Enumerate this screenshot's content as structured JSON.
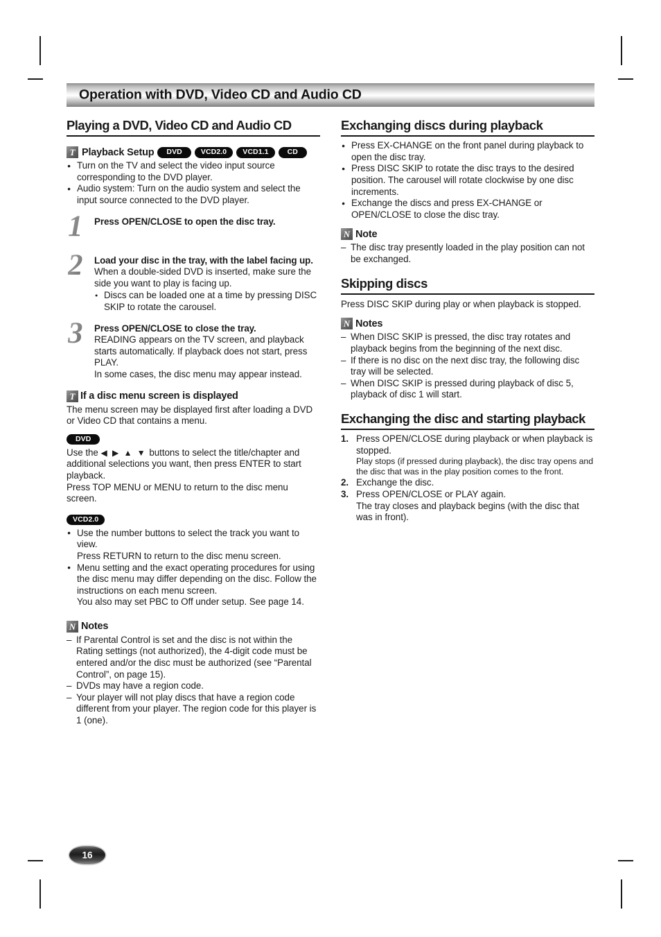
{
  "chapter": {
    "title": "Operation with DVD, Video CD and Audio CD"
  },
  "icons": {
    "tip": "T",
    "note": "N"
  },
  "left": {
    "heading": "Playing a DVD, Video CD and Audio CD",
    "playback_setup": {
      "label": "Playback Setup",
      "badges": [
        "DVD",
        "VCD2.0",
        "VCD1.1",
        "CD"
      ],
      "bullets": [
        "Turn on the TV and select the video input source corresponding to the DVD player.",
        "Audio system: Turn on the audio system and select the input source connected to the DVD player."
      ]
    },
    "steps": [
      {
        "num": "1",
        "head": "Press OPEN/CLOSE to open the disc tray.",
        "body": "",
        "bullets": []
      },
      {
        "num": "2",
        "head": "Load your disc in the tray, with the label facing up.",
        "body": "When a double-sided DVD is inserted, make sure the side you want to play is facing up.",
        "bullets": [
          "Discs can be loaded one at a time by pressing DISC SKIP to rotate the carousel."
        ]
      },
      {
        "num": "3",
        "head": "Press OPEN/CLOSE to close the tray.",
        "body": "READING appears on the TV screen, and playback starts automatically. If playback does not start, press PLAY.",
        "body2": "In some cases, the disc menu may appear instead.",
        "bullets": []
      }
    ],
    "disc_menu": {
      "label": "If a disc menu screen is displayed",
      "intro": "The menu screen may be displayed first after loading a DVD or Video CD that contains a menu.",
      "dvd_badge": "DVD",
      "dvd_para1_a": "Use the ",
      "dvd_arrows": "◀ ▶ ▲ ▼",
      "dvd_para1_b": " buttons to select the title/chapter and additional selections you want, then press ENTER to start playback.",
      "dvd_para2": "Press TOP MENU or MENU to return to the disc menu screen.",
      "vcd_badge": "VCD2.0",
      "vcd_bullets": [
        "Use the number buttons to select the track you want to view.\nPress RETURN to return to the disc menu screen.",
        "Menu setting and the exact operating procedures for using the disc menu may differ depending on the disc. Follow the instructions on each menu screen.\nYou also may set PBC to Off under setup. See page 14."
      ],
      "vcd_bullet_1_line1": "Use the number buttons to select the track you want to view.",
      "vcd_bullet_1_line2": "Press RETURN to return to the disc menu screen.",
      "vcd_bullet_2_line1": "Menu setting and the exact operating procedures for using the disc menu may differ depending on the disc. Follow the instructions on each menu screen.",
      "vcd_bullet_2_line2": "You also may set PBC to Off under setup. See page 14."
    },
    "notes": {
      "label": "Notes",
      "items": [
        "If Parental Control is set and the disc is not within the Rating settings (not authorized), the 4-digit code must be entered and/or the disc must be authorized (see “Parental Control”, on page 15).",
        "DVDs may have a region code.",
        "Your player will not play discs that have a region code different from your player. The region code for this player is 1 (one)."
      ]
    }
  },
  "right": {
    "exchanging": {
      "heading": "Exchanging discs during playback",
      "bullets": [
        "Press EX-CHANGE on the front panel during playback to open the disc tray.",
        "Press DISC SKIP to rotate the disc trays to the desired position. The carousel will rotate clockwise by one disc increments.",
        "Exchange the discs and press EX-CHANGE or OPEN/CLOSE to close the disc tray."
      ],
      "note_label": "Note",
      "note_items": [
        "The disc tray presently loaded in the play position can not be exchanged."
      ]
    },
    "skipping": {
      "heading": "Skipping discs",
      "intro": "Press DISC SKIP during play or when playback is stopped.",
      "notes_label": "Notes",
      "notes_items": [
        "When DISC SKIP is pressed, the disc tray rotates and playback begins from the beginning of the next disc.",
        "If there is no disc on the next disc tray, the following disc tray will be selected.",
        "When DISC SKIP is pressed during playback of disc 5, playback of disc 1 will start."
      ]
    },
    "exchange_start": {
      "heading": "Exchanging the disc and starting playback",
      "steps": [
        {
          "n": "1.",
          "text": "Press OPEN/CLOSE during playback or when playback is stopped.",
          "sub": "Play stops (if pressed during playback), the disc tray opens and the disc that was in the play position comes to the front."
        },
        {
          "n": "2.",
          "text": "Exchange the disc.",
          "sub": ""
        },
        {
          "n": "3.",
          "text": "Press OPEN/CLOSE or PLAY again.",
          "sub": "The tray closes and playback begins (with the disc that was in front)."
        }
      ]
    }
  },
  "footer": {
    "page_number": "16"
  }
}
